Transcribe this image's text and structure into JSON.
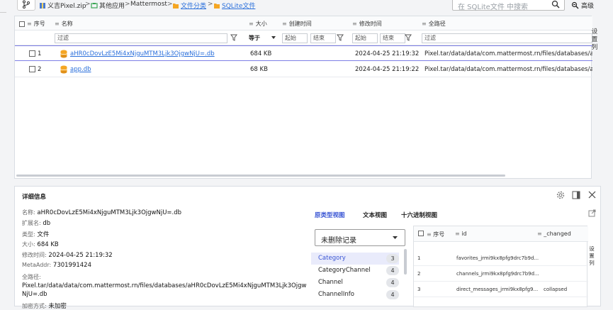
{
  "breadcrumb": {
    "items": [
      {
        "label": "义吉Pixel.zip",
        "icon": "zip-icon",
        "link": false
      },
      {
        "label": "其他应用",
        "icon": "apps-icon",
        "link": false
      },
      {
        "label": "Mattermost",
        "icon": "",
        "link": false
      },
      {
        "label": "文件分类",
        "icon": "folder-icon",
        "link": true
      },
      {
        "label": "SQLite文件",
        "icon": "folder-icon",
        "link": true
      }
    ],
    "separator": ">"
  },
  "search": {
    "placeholder": "在 SQLite文件 中搜索"
  },
  "advanced_label": "高级",
  "file_table": {
    "columns": {
      "index": "序号",
      "name": "名称",
      "size": "大小",
      "created": "创建时间",
      "modified": "修改时间",
      "path": "全路径"
    },
    "filter": {
      "placeholder": "过滤",
      "size_op": "等于",
      "from": "起始",
      "to": "结束"
    },
    "rows": [
      {
        "index": "1",
        "name": "aHR0cDovLzE5Mi4xNjguMTM3Ljk3OjgwNjU=.db",
        "size": "684 KB",
        "created": "",
        "modified": "2024-04-25 21:19:32",
        "path": "Pixel.tar/data/data/com.mattermost.rn/files/databases/aHR0cDovLzE5Mi4xNjguMTM3Ljk3OjgwNjU=.db"
      },
      {
        "index": "2",
        "name": "app.db",
        "size": "68 KB",
        "created": "",
        "modified": "2024-04-25 21:19:22",
        "path": "Pixel.tar/data/data/com.mattermost.rn/files/databases/app.db"
      }
    ],
    "side_tab": "设置列"
  },
  "detail": {
    "title": "详细信息",
    "fields": [
      {
        "key": "名称:",
        "value": "aHR0cDovLzE5Mi4xNjguMTM3Ljk3OjgwNjU=.db"
      },
      {
        "key": "扩展名:",
        "value": "db"
      },
      {
        "key": "类型:",
        "value": "文件"
      },
      {
        "key": "大小:",
        "value": "684 KB"
      },
      {
        "key": "修改时间:",
        "value": "2024-04-25 21:19:32"
      },
      {
        "key": "MetaAddr:",
        "value": "7301991424"
      }
    ],
    "fullpath_key": "全路径:",
    "fullpath_line1": "Pixel.tar/data/data/com.mattermost.rn/files/databases/aHR0cDovLzE5Mi4xNjguMTM3Ljk3OjgwNjU=.db",
    "truncated_key": "加密方式:",
    "truncated_value": "未加密",
    "tabs": [
      "原类型视图",
      "文本视图",
      "十六进制视图"
    ],
    "status_select": "未删除记录",
    "tables": [
      {
        "name": "Category",
        "count": "3"
      },
      {
        "name": "CategoryChannel",
        "count": "4"
      },
      {
        "name": "Channel",
        "count": "4"
      },
      {
        "name": "ChannelInfo",
        "count": "4"
      }
    ],
    "records": {
      "columns": {
        "index": "序号",
        "id": "id",
        "changed": "_changed"
      },
      "rows": [
        {
          "index": "1",
          "id": "favorites_jrmi9kx8pfg9drc7b9d...",
          "changed": ""
        },
        {
          "index": "2",
          "id": "channels_jrmi9kx8pfg9drc7b9d...",
          "changed": ""
        },
        {
          "index": "3",
          "id": "direct_messages_jrmi9kx8pfg9...",
          "changed": "collapsed"
        }
      ],
      "side_tab": "设置列"
    }
  },
  "colors": {
    "accent": "#3a56d4",
    "link": "#2a6fdb",
    "selected_row_border": "#7d7fe6",
    "db_icon": "#f5a623"
  }
}
